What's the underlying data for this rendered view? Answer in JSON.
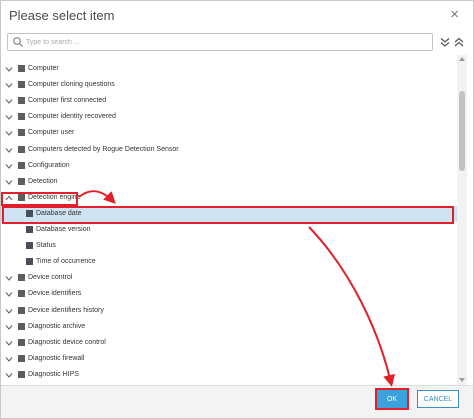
{
  "dialog": {
    "title": "Please select item",
    "close_glyph": "×"
  },
  "search": {
    "placeholder": "Type to search ...",
    "value": ""
  },
  "tree": {
    "items": [
      {
        "label": "Computer",
        "level": 0,
        "expanded": false
      },
      {
        "label": "Computer cloning questions",
        "level": 0,
        "expanded": false
      },
      {
        "label": "Computer first connected",
        "level": 0,
        "expanded": false
      },
      {
        "label": "Computer identity recovered",
        "level": 0,
        "expanded": false
      },
      {
        "label": "Computer user",
        "level": 0,
        "expanded": false
      },
      {
        "label": "Computers detected by Rogue Detection Sensor",
        "level": 0,
        "expanded": false
      },
      {
        "label": "Configuration",
        "level": 0,
        "expanded": false
      },
      {
        "label": "Detection",
        "level": 0,
        "expanded": false
      },
      {
        "label": "Detection engine",
        "level": 0,
        "expanded": true
      },
      {
        "label": "Database date",
        "level": 1,
        "selected": true
      },
      {
        "label": "Database version",
        "level": 1
      },
      {
        "label": "Status",
        "level": 1
      },
      {
        "label": "Time of occurrence",
        "level": 1
      },
      {
        "label": "Device control",
        "level": 0,
        "expanded": false
      },
      {
        "label": "Device identifiers",
        "level": 0,
        "expanded": false
      },
      {
        "label": "Device identifiers history",
        "level": 0,
        "expanded": false
      },
      {
        "label": "Diagnostic archive",
        "level": 0,
        "expanded": false
      },
      {
        "label": "Diagnostic device control",
        "level": 0,
        "expanded": false
      },
      {
        "label": "Diagnostic firewall",
        "level": 0,
        "expanded": false
      },
      {
        "label": "Diagnostic HIPS",
        "level": 0,
        "expanded": false
      }
    ]
  },
  "footer": {
    "ok_label": "OK",
    "cancel_label": "CANCEL"
  },
  "colors": {
    "accent": "#3aa2dd",
    "selection": "#cfe3f3",
    "annotation": "#e0202a"
  },
  "icons": {
    "search": "search-icon",
    "expand_all": "chevron-double-down-icon",
    "collapse_all": "chevron-double-up-icon",
    "close": "close-icon"
  }
}
